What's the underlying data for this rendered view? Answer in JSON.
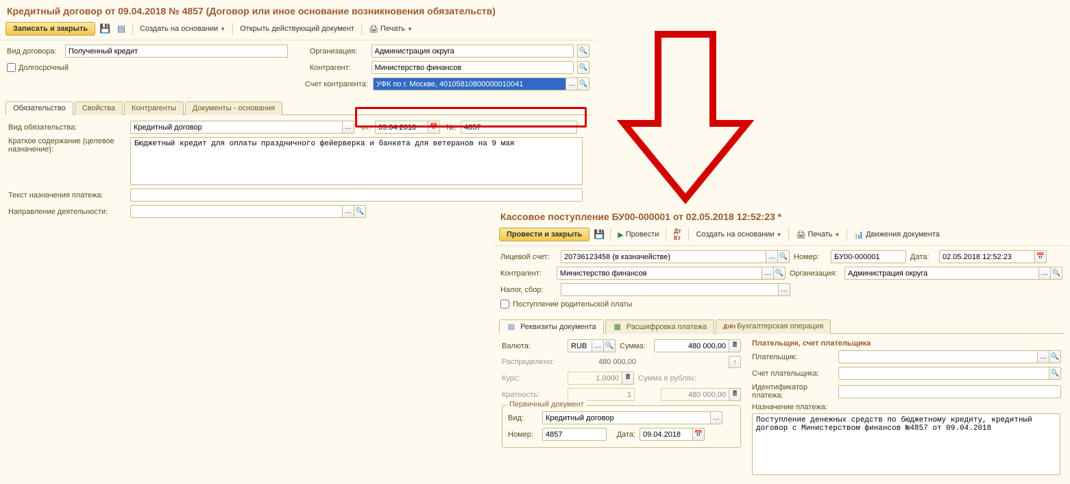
{
  "left": {
    "title": "Кредитный договор от 09.04.2018 № 4857 (Договор или иное основание возникновения обязательств)",
    "toolbar": {
      "save_close": "Записать и закрыть",
      "create_based": "Создать на основании",
      "open_active": "Открыть действующий документ",
      "print": "Печать"
    },
    "labels": {
      "contract_type": "Вид договора:",
      "long_term": "Долгосрочный",
      "organization": "Организация:",
      "counterparty": "Контрагент:",
      "cp_account": "Счет контрагента:"
    },
    "values": {
      "contract_type": "Полученный кредит",
      "organization": "Администрация округа",
      "counterparty": "Министерство финансов",
      "cp_account": "УФК по г. Москве, 40105810800000010041"
    },
    "tabs": [
      "Обязательство",
      "Свойства",
      "Контрагенты",
      "Документы - основания"
    ],
    "obl": {
      "l_type": "Вид обязательства:",
      "v_type": "Кредитный договор",
      "l_from": "от:",
      "v_from": "09.04.2018",
      "l_num": "№:",
      "v_num": "4857",
      "l_summary": "Краткое содержание (целевое назначение):",
      "v_summary": "Бюджетный кредит для оплаты праздничного фейерверка и банкета для ветеранов на 9 мая",
      "l_payment_text": "Текст назначения платежа:",
      "l_activity": "Направление деятельности:"
    }
  },
  "right": {
    "title": "Кассовое поступление БУ00-000001 от 02.05.2018 12:52:23 *",
    "toolbar": {
      "post_close": "Провести и закрыть",
      "post": "Провести",
      "create_based": "Создать на основании",
      "print": "Печать",
      "movements": "Движения документа"
    },
    "labels": {
      "account": "Лицевой счет:",
      "number": "Номер:",
      "date": "Дата:",
      "counterparty": "Контрагент:",
      "organization": "Организация:",
      "tax": "Налог, сбор:",
      "parent_pay": "Поступление родительской платы"
    },
    "values": {
      "account": "20736123458 (в казначействе)",
      "number": "БУ00-000001",
      "date": "02.05.2018 12:52:23",
      "counterparty": "Министерство финансов",
      "organization": "Администрация округа"
    },
    "tabs": [
      "Реквизиты документа",
      "Расшифровка платежа",
      "Бухгалтерская операция"
    ],
    "req": {
      "l_currency": "Валюта:",
      "v_currency": "RUB",
      "l_sum": "Сумма:",
      "v_sum": "480 000,00",
      "l_alloc": "Распределено:",
      "v_alloc": "480 000,00",
      "l_rate": "Курс:",
      "v_rate": "1,0000",
      "l_sum_rub": "Сумма в рублях:",
      "v_sum_rub": "480 000,00",
      "l_mult": "Кратность:",
      "v_mult": "1",
      "fs_primary": "Первичный документ",
      "l_pd_type": "Вид:",
      "v_pd_type": "Кредитный договор",
      "l_pd_num": "Номер:",
      "v_pd_num": "4857",
      "l_pd_date": "Дата:",
      "v_pd_date": "09.04.2018",
      "payer_section": "Плательщик, счет плательщика",
      "l_payer": "Плательщик:",
      "l_payer_acc": "Счет плательщика:",
      "l_payment_id": "Идентификатор платежа:",
      "l_purpose": "Назначение платежа:",
      "v_purpose": "Поступление денежных средств по бюджетному кредиту, кредитный договор с Министерством финансов №4857 от 09.04.2018"
    }
  }
}
